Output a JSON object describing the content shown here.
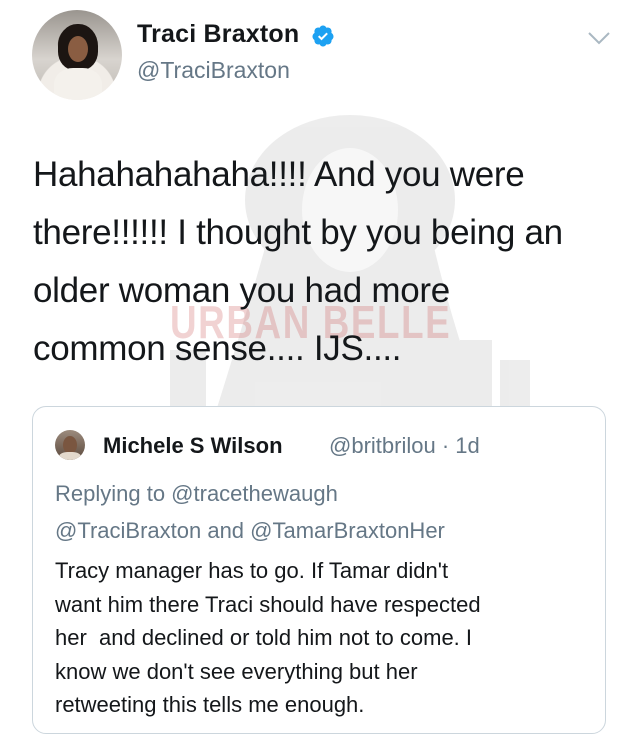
{
  "tweet": {
    "display_name": "Traci Braxton",
    "handle": "@TraciBraxton",
    "verified": true,
    "text": "Hahahahahaha!!!! And you were\nthere!!!!!! I thought by you being an\nolder woman you had more\ncommon sense.... IJS....",
    "watermark": "URBAN BELLE"
  },
  "quoted_tweet": {
    "display_name": "Michele S Wilson",
    "meta": "@britbrilou · 1d",
    "replying_to_line1": "Replying to @tracethewaugh",
    "replying_to_line2": "@TraciBraxton and @TamarBraxtonHer",
    "text": "Tracy manager has to go. If Tamar didn't\nwant him there Traci should have respected\nher  and declined or told him not to come. I\nknow we don't see everything but her\nretweeting this tells me enough."
  },
  "colors": {
    "primary_text": "#14171a",
    "secondary_text": "#657786",
    "verified_blue": "#1da1f2",
    "border": "#ccd6dd"
  },
  "icons": {
    "verified": "verified-badge-icon",
    "menu": "chevron-down-icon"
  }
}
